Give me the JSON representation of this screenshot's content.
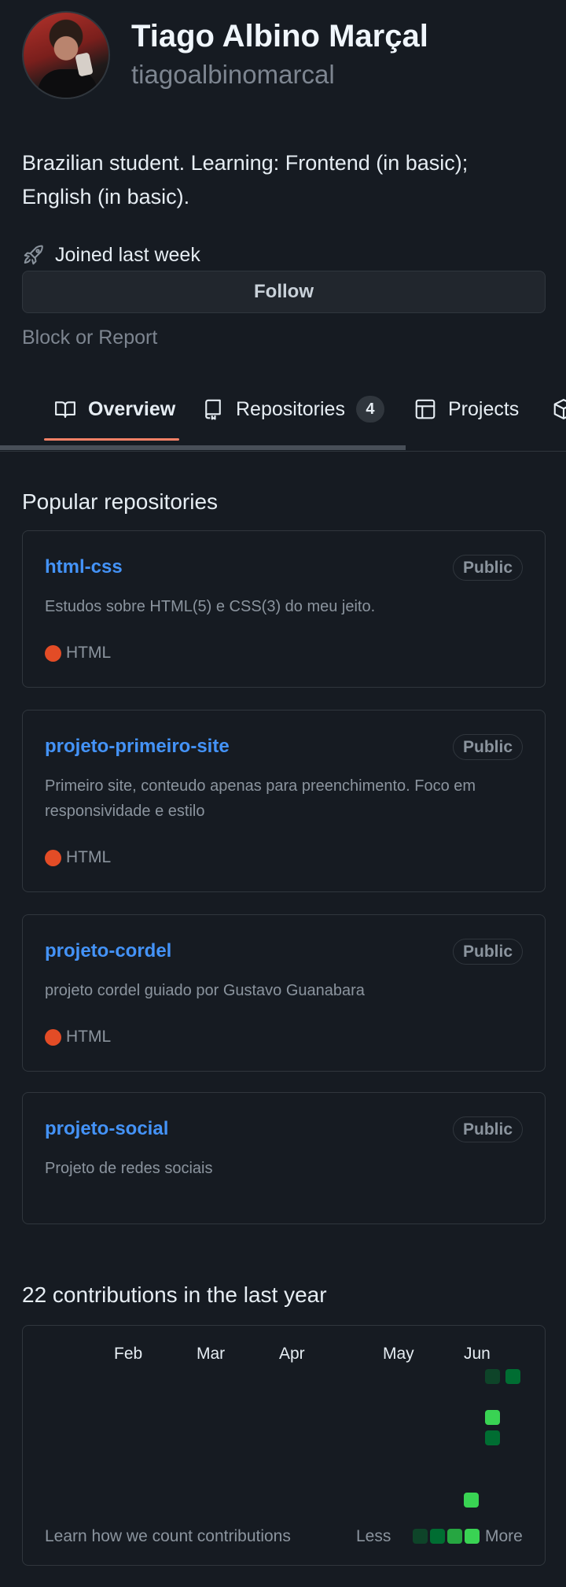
{
  "profile": {
    "fullname": "Tiago Albino Marçal",
    "username": "tiagoalbinomarcal",
    "bio": "Brazilian student. Learning: Frontend (in basic); English (in basic).",
    "joined": "Joined last week",
    "follow_label": "Follow",
    "block_report_label": "Block or Report"
  },
  "tabs": [
    {
      "label": "Overview",
      "icon": "book-icon",
      "active": true
    },
    {
      "label": "Repositories",
      "icon": "repo-icon",
      "count": "4"
    },
    {
      "label": "Projects",
      "icon": "table-icon"
    },
    {
      "label": "",
      "icon": "package-icon"
    }
  ],
  "popular": {
    "title": "Popular repositories",
    "repos": [
      {
        "name": "html-css",
        "visibility": "Public",
        "description": "Estudos sobre HTML(5) e CSS(3) do meu jeito.",
        "language": "HTML",
        "language_color": "#e34c26"
      },
      {
        "name": "projeto-primeiro-site",
        "visibility": "Public",
        "description": "Primeiro site, conteudo apenas para preenchimento. Foco em responsividade e estilo",
        "language": "HTML",
        "language_color": "#e34c26"
      },
      {
        "name": "projeto-cordel",
        "visibility": "Public",
        "description": "projeto cordel guiado por Gustavo Guanabara",
        "language": "HTML",
        "language_color": "#e34c26"
      },
      {
        "name": "projeto-social",
        "visibility": "Public",
        "description": "Projeto de redes sociais",
        "language": null,
        "language_color": null
      }
    ]
  },
  "contributions": {
    "title": "22 contributions in the last year",
    "months": [
      "Feb",
      "Mar",
      "Apr",
      "May",
      "Jun"
    ],
    "learn_label": "Learn how we count contributions",
    "legend_less": "Less",
    "legend_more": "More",
    "colors": {
      "level1": "#0e4429",
      "level2": "#006d32",
      "level3": "#26a641",
      "level4": "#39d353",
      "accent_link": "#4493f8",
      "tab_underline": "#f78166"
    }
  }
}
